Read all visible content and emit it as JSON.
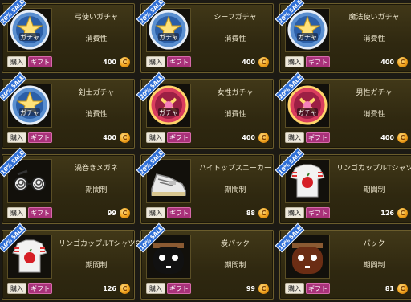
{
  "common": {
    "buy_label": "購入",
    "gift_label": "ギフト",
    "coin_symbol": "C"
  },
  "items": [
    {
      "name": "弓使いガチャ",
      "type": "消費性",
      "price": "400",
      "sale": "20% SALE",
      "icon": "gacha-medal-star-icon"
    },
    {
      "name": "シーフガチャ",
      "type": "消費性",
      "price": "400",
      "sale": "20% SALE",
      "icon": "gacha-medal-star-icon"
    },
    {
      "name": "魔法使いガチャ",
      "type": "消費性",
      "price": "400",
      "sale": "20% SALE",
      "icon": "gacha-medal-star-icon"
    },
    {
      "name": "剣士ガチャ",
      "type": "消費性",
      "price": "400",
      "sale": "20% SALE",
      "icon": "gacha-medal-star-icon"
    },
    {
      "name": "女性ガチャ",
      "type": "消費性",
      "price": "400",
      "sale": "20% SALE",
      "icon": "gacha-medal-pink-icon"
    },
    {
      "name": "男性ガチャ",
      "type": "消費性",
      "price": "400",
      "sale": "20% SALE",
      "icon": "gacha-medal-pink-icon"
    },
    {
      "name": "渦巻きメガネ",
      "type": "期間制",
      "price": "99",
      "sale": "10% SALE",
      "icon": "swirl-glasses-icon"
    },
    {
      "name": "ハイトップスニーカー",
      "type": "期間制",
      "price": "88",
      "sale": "20% SALE",
      "icon": "sneaker-icon"
    },
    {
      "name": "リンゴカップルTシャツ♂",
      "type": "期間制",
      "price": "126",
      "sale": "10% SALE",
      "icon": "apple-tshirt-icon"
    },
    {
      "name": "リンゴカップルTシャツ♀",
      "type": "期間制",
      "price": "126",
      "sale": "10% SALE",
      "icon": "apple-tshirt-icon"
    },
    {
      "name": "炭パック",
      "type": "期間制",
      "price": "99",
      "sale": "10% SALE",
      "icon": "charcoal-pack-face-icon"
    },
    {
      "name": "パック",
      "type": "期間制",
      "price": "81",
      "sale": "10% SALE",
      "icon": "clay-pack-face-icon"
    }
  ]
}
